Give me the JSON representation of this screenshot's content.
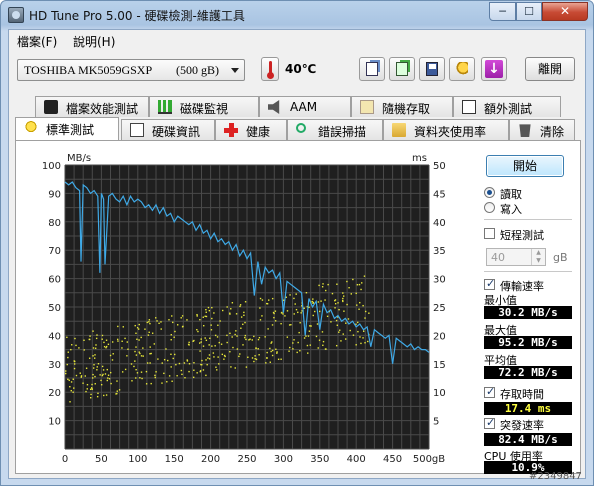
{
  "window": {
    "title": "HD Tune Pro  5.00 - 硬碟檢測-維護工具",
    "min_label": "─",
    "max_label": "☐",
    "close_label": "✕"
  },
  "menu": [
    "檔案(F)",
    "說明(H)"
  ],
  "toolbar": {
    "drive_name": "TOSHIBA MK5059GSXP",
    "drive_size": "(500 gB)",
    "temperature": "40℃",
    "exit_label": "離開",
    "icons": [
      "copy-text-icon",
      "copy-screenshot-icon",
      "save-icon",
      "options-icon",
      "download-icon"
    ]
  },
  "tabs_top": [
    {
      "label": "檔案效能測試",
      "icon": "file-benchmark-icon"
    },
    {
      "label": "磁碟監視",
      "icon": "disk-monitor-icon"
    },
    {
      "label": "AAM",
      "icon": "speaker-icon"
    },
    {
      "label": "隨機存取",
      "icon": "random-access-icon"
    },
    {
      "label": "額外測試",
      "icon": "extra-tests-icon"
    }
  ],
  "tabs_bottom": [
    {
      "label": "標準測試",
      "icon": "bulb-icon",
      "active": true
    },
    {
      "label": "硬碟資訊",
      "icon": "info-icon"
    },
    {
      "label": "健康",
      "icon": "health-cross-icon"
    },
    {
      "label": "錯誤掃描",
      "icon": "magnifier-icon"
    },
    {
      "label": "資料夾使用率",
      "icon": "folder-icon"
    },
    {
      "label": "清除",
      "icon": "trash-icon"
    }
  ],
  "side": {
    "start_label": "開始",
    "read_label": "讀取",
    "write_label": "寫入",
    "mode_selected": "read",
    "short_test_label": "短程測試",
    "short_test_checked": false,
    "short_test_value": "40",
    "short_test_unit": "gB",
    "transfer_label": "傳輸速率",
    "transfer_checked": true,
    "min_label": "最小值",
    "min_value": "30.2 MB/s",
    "max_label": "最大值",
    "max_value": "95.2 MB/s",
    "avg_label": "平均值",
    "avg_value": "72.2 MB/s",
    "access_label": "存取時間",
    "access_checked": true,
    "access_value": "17.4 ms",
    "burst_label": "突發速率",
    "burst_checked": true,
    "burst_value": "82.4 MB/s",
    "cpu_label": "CPU 使用率",
    "cpu_value": "10.9%"
  },
  "watermark": "#2349847",
  "chart_data": {
    "type": "line",
    "y_left_label": "MB/s",
    "y_right_label": "ms",
    "x_unit": "gB",
    "x_ticks": [
      0,
      50,
      100,
      150,
      200,
      250,
      300,
      350,
      400,
      450,
      500
    ],
    "y_left_ticks": [
      10,
      20,
      30,
      40,
      50,
      60,
      70,
      80,
      90,
      100
    ],
    "y_right_ticks": [
      5,
      10,
      15,
      20,
      25,
      30,
      35,
      40,
      45,
      50
    ],
    "xlim": [
      0,
      500
    ],
    "ylim_left": [
      0,
      100
    ],
    "ylim_right": [
      0,
      50
    ],
    "grid": true,
    "background": "#1f1f1f",
    "grid_color": "#4a4a4a",
    "colors": {
      "transfer": "#3fa9e6",
      "access": "#e8e83a"
    },
    "series": [
      {
        "name": "傳輸速率",
        "axis": "left",
        "x": [
          0,
          5,
          10,
          15,
          20,
          22,
          25,
          30,
          35,
          40,
          45,
          48,
          50,
          53,
          55,
          60,
          65,
          70,
          75,
          80,
          85,
          90,
          95,
          100,
          105,
          110,
          115,
          120,
          125,
          130,
          135,
          140,
          145,
          150,
          155,
          160,
          165,
          170,
          175,
          180,
          185,
          190,
          195,
          200,
          205,
          210,
          215,
          220,
          225,
          230,
          235,
          240,
          245,
          250,
          255,
          260,
          265,
          270,
          275,
          280,
          285,
          290,
          295,
          300,
          305,
          310,
          315,
          320,
          325,
          330,
          335,
          340,
          345,
          350,
          355,
          360,
          365,
          370,
          375,
          380,
          385,
          390,
          395,
          400,
          405,
          410,
          415,
          420,
          425,
          430,
          435,
          440,
          445,
          450,
          455,
          460,
          465,
          470,
          475,
          480,
          485,
          490,
          495,
          500
        ],
        "values": [
          94,
          93,
          94,
          92,
          91,
          66,
          93,
          92,
          90,
          91,
          89,
          62,
          90,
          88,
          65,
          89,
          90,
          88,
          87,
          89,
          86,
          89,
          87,
          88,
          87,
          85,
          86,
          84,
          86,
          83,
          85,
          82,
          83,
          80,
          82,
          81,
          80,
          79,
          80,
          77,
          79,
          76,
          77,
          74,
          76,
          73,
          74,
          72,
          73,
          70,
          72,
          68,
          70,
          67,
          69,
          54,
          66,
          58,
          64,
          62,
          63,
          60,
          62,
          48,
          59,
          58,
          57,
          56,
          55,
          40,
          53,
          50,
          52,
          42,
          51,
          48,
          49,
          46,
          47,
          45,
          46,
          44,
          45,
          43,
          44,
          42,
          43,
          36,
          42,
          41,
          40,
          39,
          40,
          30,
          39,
          38,
          37,
          36,
          37,
          35,
          36,
          35,
          35,
          34
        ]
      },
      {
        "name": "存取時間",
        "axis": "right",
        "style": "scatter",
        "x_range": [
          0,
          420
        ],
        "trend_start": 14,
        "trend_end": 25,
        "spread": 6
      }
    ]
  }
}
